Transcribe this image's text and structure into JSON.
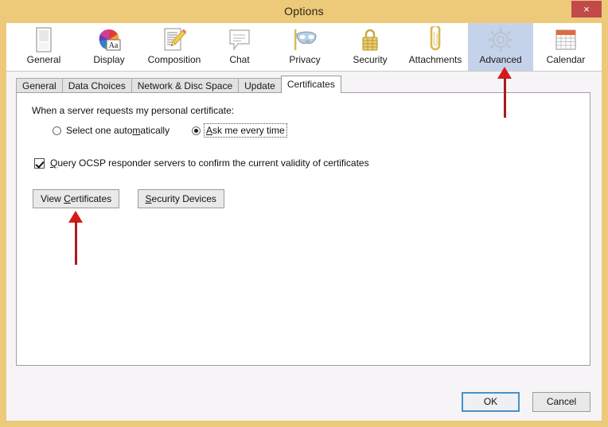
{
  "window": {
    "title": "Options",
    "close_label": "×",
    "frame_color": "#edc97a"
  },
  "toolbar": {
    "items": [
      {
        "label": "General",
        "icon": "general-panel-icon",
        "selected": false
      },
      {
        "label": "Display",
        "icon": "display-colorwheel-icon",
        "selected": false
      },
      {
        "label": "Composition",
        "icon": "composition-pencil-icon",
        "selected": false
      },
      {
        "label": "Chat",
        "icon": "chat-bubble-icon",
        "selected": false
      },
      {
        "label": "Privacy",
        "icon": "privacy-mask-icon",
        "selected": false
      },
      {
        "label": "Security",
        "icon": "security-padlock-icon",
        "selected": false
      },
      {
        "label": "Attachments",
        "icon": "attachments-paperclip-icon",
        "selected": false
      },
      {
        "label": "Advanced",
        "icon": "advanced-gear-icon",
        "selected": true
      },
      {
        "label": "Calendar",
        "icon": "calendar-icon",
        "selected": false
      }
    ],
    "selected_accent": "#c5d3ea"
  },
  "tabs": {
    "items": [
      {
        "label": "General",
        "active": false
      },
      {
        "label": "Data Choices",
        "active": false
      },
      {
        "label": "Network & Disc Space",
        "active": false
      },
      {
        "label": "Update",
        "active": false
      },
      {
        "label": "Certificates",
        "active": true
      }
    ]
  },
  "certificates_pane": {
    "prompt_label": "When a server requests my personal certificate:",
    "radio_options": [
      {
        "label_pre": "Select one auto",
        "accel": "m",
        "label_post": "atically",
        "selected": false,
        "focused": false
      },
      {
        "label_pre": "",
        "accel": "A",
        "label_post": "sk me every time",
        "selected": true,
        "focused": true
      }
    ],
    "checkbox": {
      "label_pre": "",
      "accel": "Q",
      "label_post": "uery OCSP responder servers to confirm the current validity of certificates",
      "checked": true
    },
    "buttons": [
      {
        "label_pre": "View ",
        "accel": "C",
        "label_post": "ertificates"
      },
      {
        "label_pre": "",
        "accel": "S",
        "label_post": "ecurity Devices"
      }
    ]
  },
  "footer": {
    "ok_label": "OK",
    "cancel_label": "Cancel"
  },
  "annotations": {
    "arrow_color": "#d31a1a",
    "arrows": [
      {
        "name": "arrow-pointing-advanced-tab",
        "target": "Advanced"
      },
      {
        "name": "arrow-pointing-view-certificates-button",
        "target": "View Certificates"
      }
    ]
  }
}
